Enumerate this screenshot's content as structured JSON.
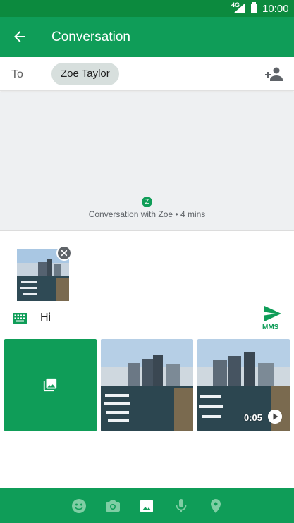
{
  "status_bar": {
    "network": "4G",
    "time": "10:00"
  },
  "app_bar": {
    "title": "Conversation"
  },
  "recipient": {
    "to_label": "To",
    "chip_name": "Zoe Taylor"
  },
  "conversation": {
    "avatar_letter": "Z",
    "meta": "Conversation with Zoe • 4 mins"
  },
  "compose": {
    "text": "Hi",
    "send_label": "MMS"
  },
  "gallery": {
    "video_duration": "0:05"
  },
  "bottom_bar": {
    "buttons": [
      "emoji-icon",
      "camera-icon",
      "gallery-icon",
      "microphone-icon",
      "location-icon"
    ]
  },
  "colors": {
    "primary": "#0f9d58",
    "status_bar": "#0c8a3e",
    "chip": "#d7dfdd",
    "background": "#eef0f2"
  }
}
